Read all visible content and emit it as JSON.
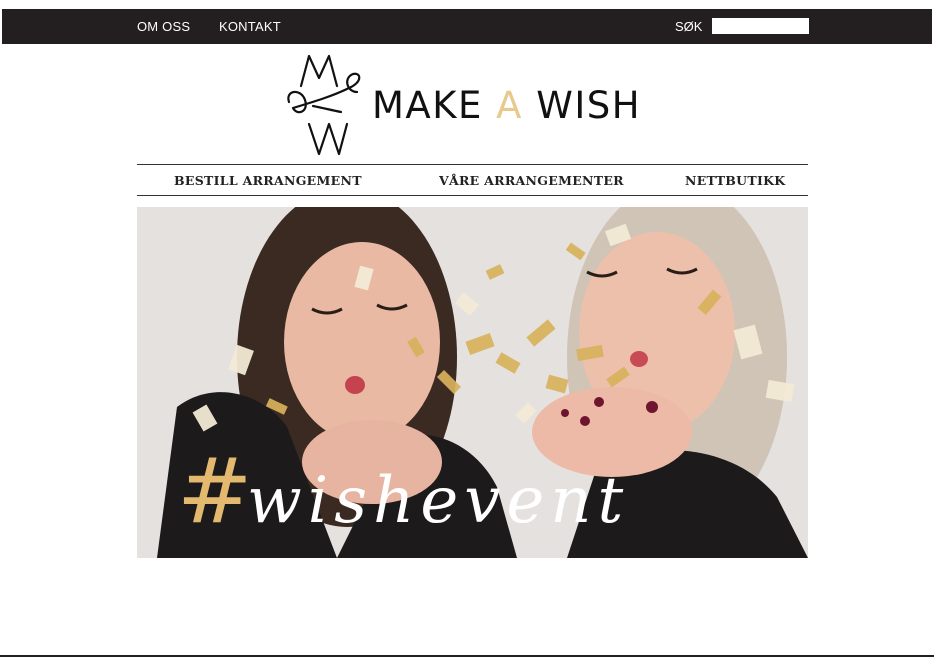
{
  "topbar": {
    "links": [
      "OM OSS",
      "KONTAKT"
    ],
    "search_label": "SØK",
    "search_value": ""
  },
  "logo": {
    "word1": "MAKE",
    "word2": "A",
    "word3": "WISH",
    "accent_color": "#e8c98e"
  },
  "nav": {
    "items": [
      "BESTILL ARRANGEMENT",
      "VÅRE ARRANGEMENTER",
      "NETTBUTIKK"
    ]
  },
  "hero": {
    "hashtag": "#",
    "word": "wishevent"
  },
  "colors": {
    "topbar": "#231f20",
    "gold": "#e3b86f"
  },
  "icons": [
    "make-a-wish-monogram-icon"
  ]
}
